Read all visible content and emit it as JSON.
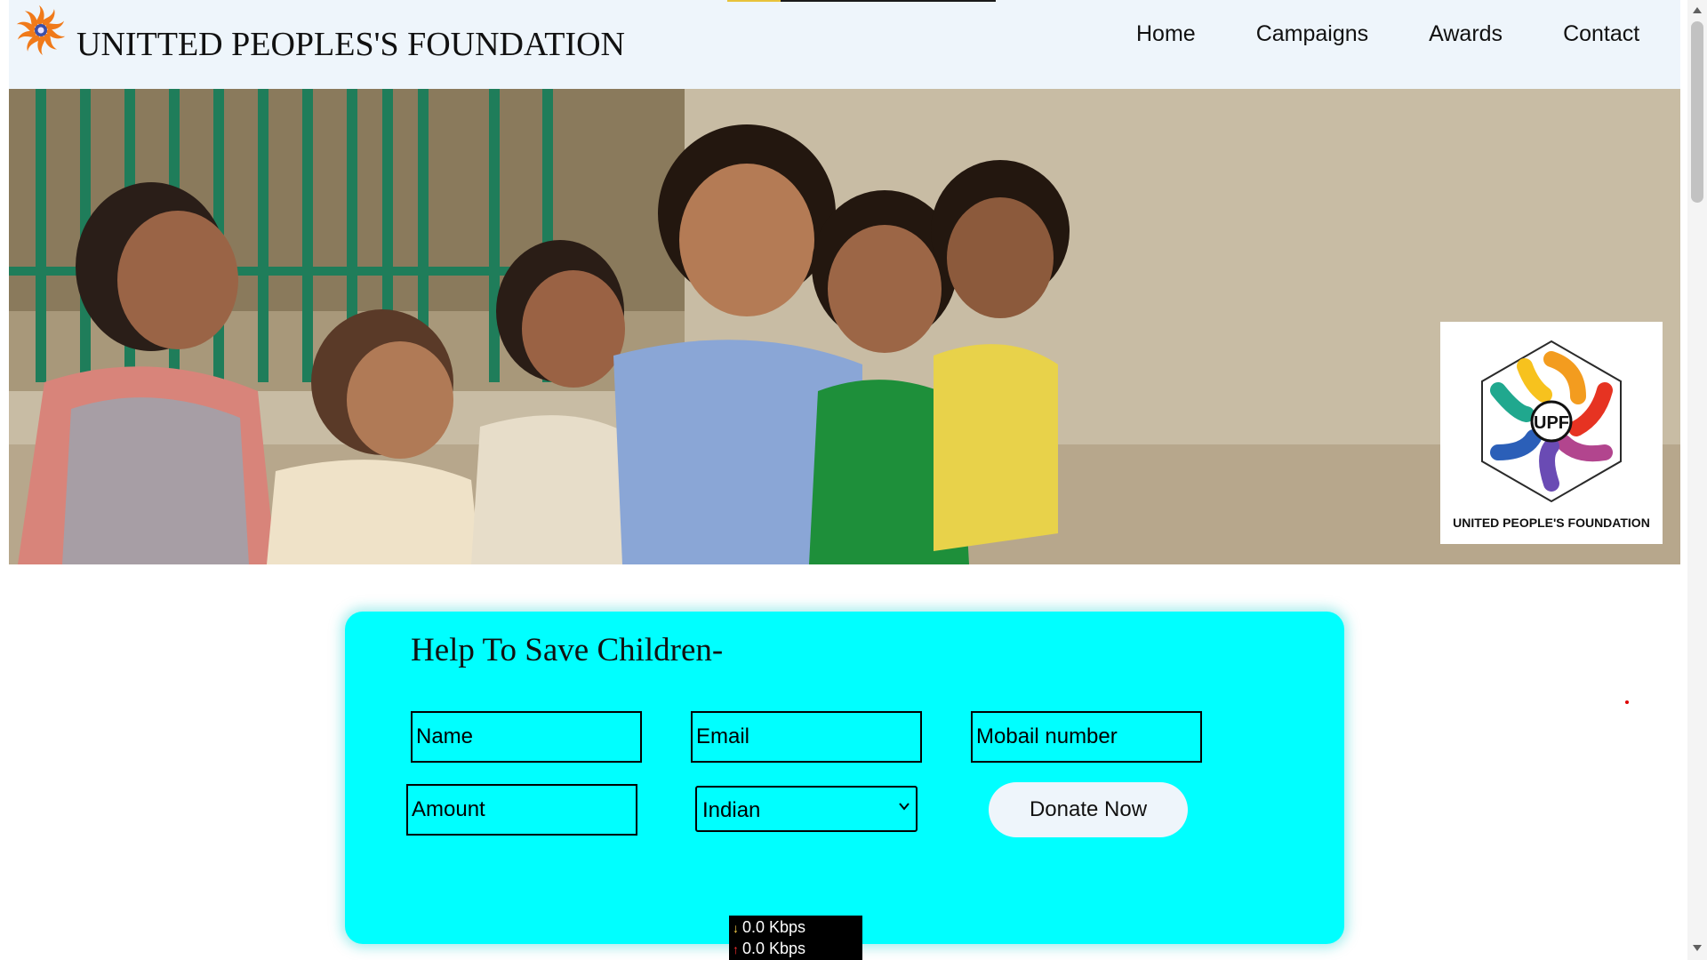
{
  "header": {
    "title": "UNITTED PEOPLES'S FOUNDATION",
    "logo_icon": "sun-swirl-logo-icon",
    "nav": [
      {
        "label": "Home"
      },
      {
        "label": "Campaigns"
      },
      {
        "label": "Awards"
      },
      {
        "label": "Contact"
      }
    ]
  },
  "hero": {
    "image": "children-group-photo",
    "badge_label": "UNITED PEOPLE'S FOUNDATION",
    "badge_monogram": "UPF"
  },
  "donation": {
    "heading": "Help To Save Children-",
    "name_placeholder": "Name",
    "email_placeholder": "Email",
    "mobile_placeholder": "Mobail number",
    "amount_placeholder": "Amount",
    "currency_selected": "Indian",
    "button_label": "Donate Now"
  },
  "speed_overlay": {
    "download": "0.0 Kbps",
    "upload": "0.0 Kbps",
    "download_color": "#ffd24a",
    "upload_color": "#ff3030"
  },
  "colors": {
    "panel": "#00ffff",
    "header_bg": "#eef5fb",
    "button_bg": "#eef5fb"
  }
}
